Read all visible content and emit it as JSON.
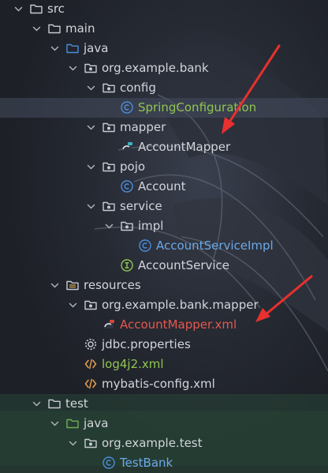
{
  "tree": [
    {
      "label": "src",
      "depth": 0,
      "expanded": true,
      "icon": "folder-icon"
    },
    {
      "label": "main",
      "depth": 1,
      "expanded": true,
      "icon": "folder-icon"
    },
    {
      "label": "java",
      "depth": 2,
      "expanded": true,
      "icon": "source-folder-icon"
    },
    {
      "label": "org.example.bank",
      "depth": 3,
      "expanded": true,
      "icon": "package-icon"
    },
    {
      "label": "config",
      "depth": 4,
      "expanded": true,
      "icon": "package-icon"
    },
    {
      "label": "SpringConfiguration",
      "depth": 5,
      "icon": "class-icon",
      "color": "green",
      "selected": true
    },
    {
      "label": "mapper",
      "depth": 4,
      "expanded": true,
      "icon": "package-icon"
    },
    {
      "label": "AccountMapper",
      "depth": 5,
      "icon": "mybatis-mapper-icon"
    },
    {
      "label": "pojo",
      "depth": 4,
      "expanded": true,
      "icon": "package-icon"
    },
    {
      "label": "Account",
      "depth": 5,
      "icon": "class-icon"
    },
    {
      "label": "service",
      "depth": 4,
      "expanded": true,
      "icon": "package-icon"
    },
    {
      "label": "impl",
      "depth": 5,
      "expanded": true,
      "icon": "package-icon"
    },
    {
      "label": "AccountServiceImpl",
      "depth": 6,
      "icon": "class-icon",
      "color": "blue"
    },
    {
      "label": "AccountService",
      "depth": 5,
      "icon": "interface-icon"
    },
    {
      "label": "resources",
      "depth": 2,
      "expanded": true,
      "icon": "resources-folder-icon"
    },
    {
      "label": "org.example.bank.mapper",
      "depth": 3,
      "expanded": true,
      "icon": "package-icon"
    },
    {
      "label": "AccountMapper.xml",
      "depth": 4,
      "icon": "mybatis-xml-icon",
      "color": "red"
    },
    {
      "label": "jdbc.properties",
      "depth": 3,
      "icon": "properties-gear-icon"
    },
    {
      "label": "log4j2.xml",
      "depth": 3,
      "icon": "xml-file-icon",
      "color": "green"
    },
    {
      "label": "mybatis-config.xml",
      "depth": 3,
      "icon": "xml-file-icon"
    },
    {
      "label": "test",
      "depth": 1,
      "expanded": true,
      "icon": "folder-icon",
      "area": "test"
    },
    {
      "label": "java",
      "depth": 2,
      "expanded": true,
      "icon": "test-folder-icon",
      "area": "test"
    },
    {
      "label": "org.example.test",
      "depth": 3,
      "expanded": true,
      "icon": "package-icon",
      "area": "test"
    },
    {
      "label": "TestBank",
      "depth": 4,
      "icon": "class-icon",
      "color": "blue",
      "area": "test"
    }
  ],
  "colors": {
    "accent_blue": "#4a8ddb",
    "class_blue": "#6aa9e8",
    "interface_green": "#8fc552",
    "modified_green": "#8fc552",
    "error_red": "#e5584e",
    "arrow_red": "#e8302e"
  }
}
